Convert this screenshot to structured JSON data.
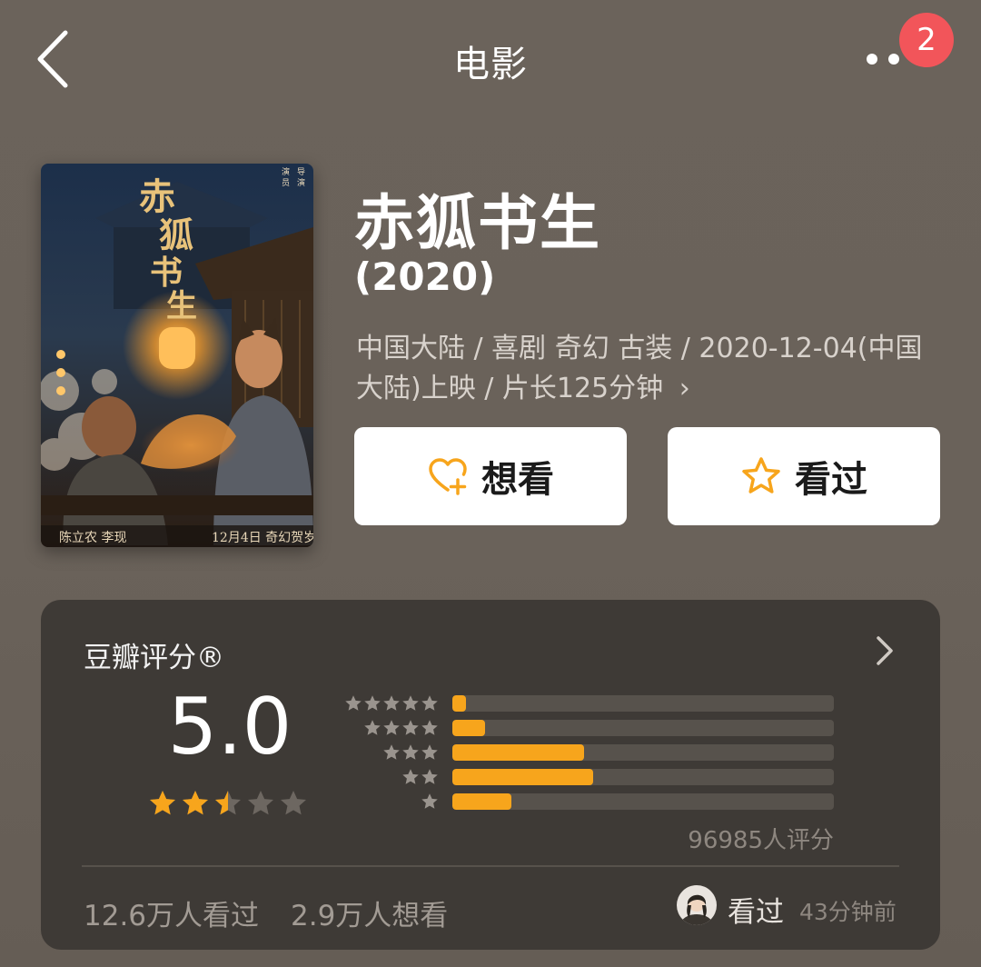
{
  "header": {
    "title": "电影",
    "badge_count": "2"
  },
  "movie": {
    "title": "赤狐书生",
    "year": "(2020)",
    "meta": "中国大陆 / 喜剧 奇幻 古装 / 2020-12-04(中国大陆)上映 / 片长125分钟",
    "meta_chevron": "›",
    "poster": {
      "title_calligraphy": "赤狐书生",
      "cast_text": "陈立农 李现",
      "release_text": "12月4日 奇幻贺岁"
    }
  },
  "actions": {
    "want_label": "想看",
    "seen_label": "看过"
  },
  "rating": {
    "label": "豆瓣评分®",
    "score": "5.0",
    "star_rating_out_of_5": 2.5,
    "distribution_percent": [
      {
        "stars": 5,
        "percent": 3.5
      },
      {
        "stars": 4,
        "percent": 8.5
      },
      {
        "stars": 3,
        "percent": 34.5
      },
      {
        "stars": 2,
        "percent": 37.0
      },
      {
        "stars": 1,
        "percent": 15.5
      }
    ],
    "raters": "96985人评分",
    "seen_count": "12.6万人看过",
    "want_count": "2.9万人想看",
    "friend_action": "看过",
    "friend_time": "43分钟前"
  },
  "colors": {
    "background": "#6a625a",
    "card": "#3e3a36",
    "accent": "#f7a51c",
    "badge": "#f2555a"
  }
}
